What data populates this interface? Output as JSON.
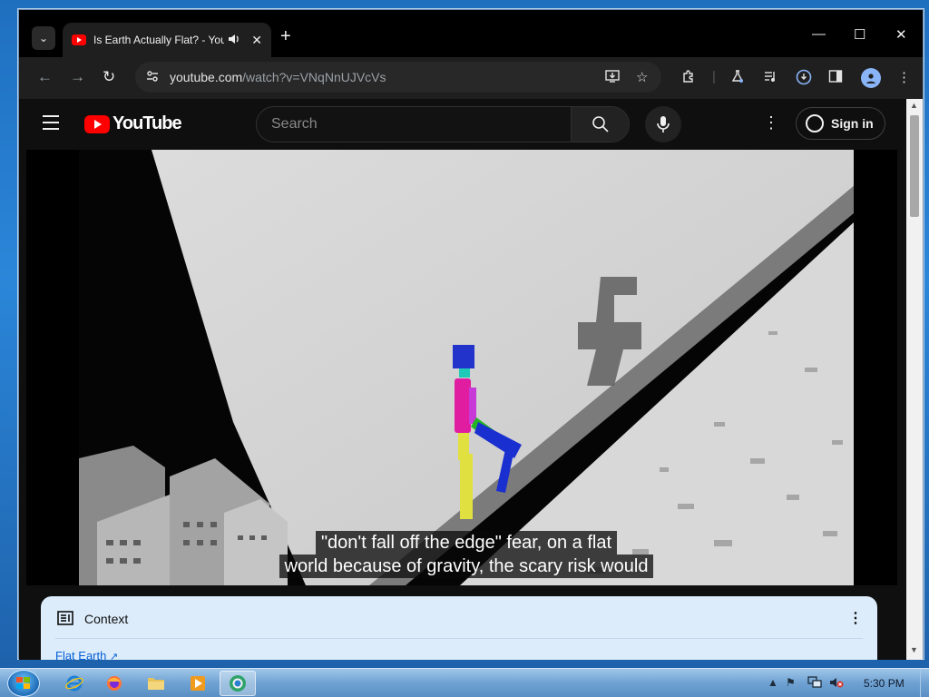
{
  "browser": {
    "tab": {
      "title": "Is Earth Actually Flat? - YouTube",
      "audio_icon": "speaker-icon",
      "close_glyph": "✕"
    },
    "new_tab_glyph": "+",
    "window_controls": {
      "minimize": "—",
      "maximize": "☐",
      "close": "✕"
    },
    "toolbar": {
      "back_glyph": "←",
      "forward_glyph": "→",
      "reload_glyph": "↻",
      "url_host": "youtube.com",
      "url_path": "/watch?v=VNqNnUJVcVs"
    }
  },
  "youtube": {
    "logo_text": "YouTube",
    "search_placeholder": "Search",
    "more_glyph": "⋮",
    "signin_label": "Sign in",
    "captions": [
      "\"don't fall off the edge\" fear, on a flat",
      "world because of gravity, the scary risk would"
    ],
    "context": {
      "title": "Context",
      "more_glyph": "⋮",
      "link_label": "Flat Earth"
    }
  },
  "taskbar": {
    "apps": [
      "internet-explorer",
      "firefox",
      "file-explorer",
      "media-player",
      "chrome"
    ],
    "clock": "5:30 PM"
  },
  "colors": {
    "youtube_red": "#ff0000",
    "page_bg": "#0f0f0f",
    "context_bg": "#dcecfb",
    "link_blue": "#065fd4"
  }
}
